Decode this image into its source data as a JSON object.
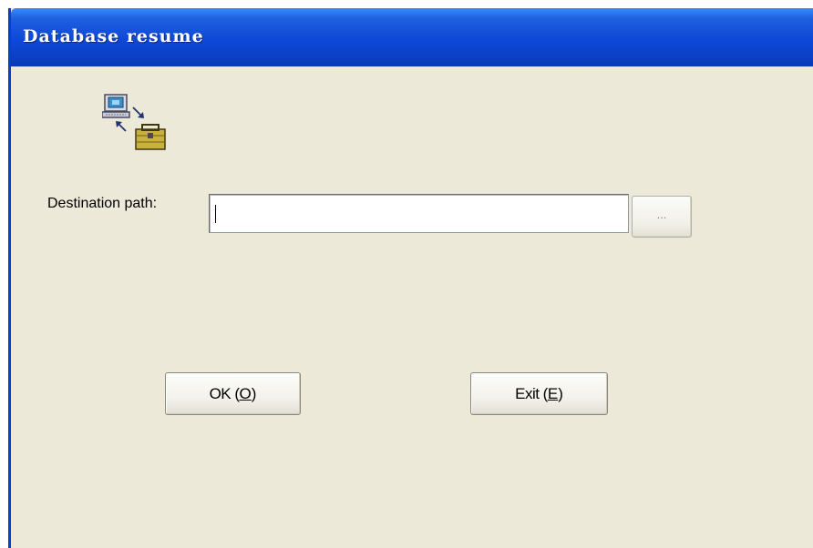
{
  "window": {
    "title": "Database resume"
  },
  "icons": {
    "app_icon": "computer-to-database-transfer-icon"
  },
  "form": {
    "destination_label": "Destination path:",
    "destination_value": "",
    "browse_label": "..."
  },
  "buttons": {
    "ok": {
      "prefix": "OK (",
      "mnemonic": "O",
      "suffix": ")"
    },
    "exit": {
      "prefix": "Exit (",
      "mnemonic": "E",
      "suffix": ")"
    }
  },
  "colors": {
    "title_bar": "#0b3fc4",
    "dialog_background": "#ece9d8",
    "title_text": "#ffffff"
  }
}
